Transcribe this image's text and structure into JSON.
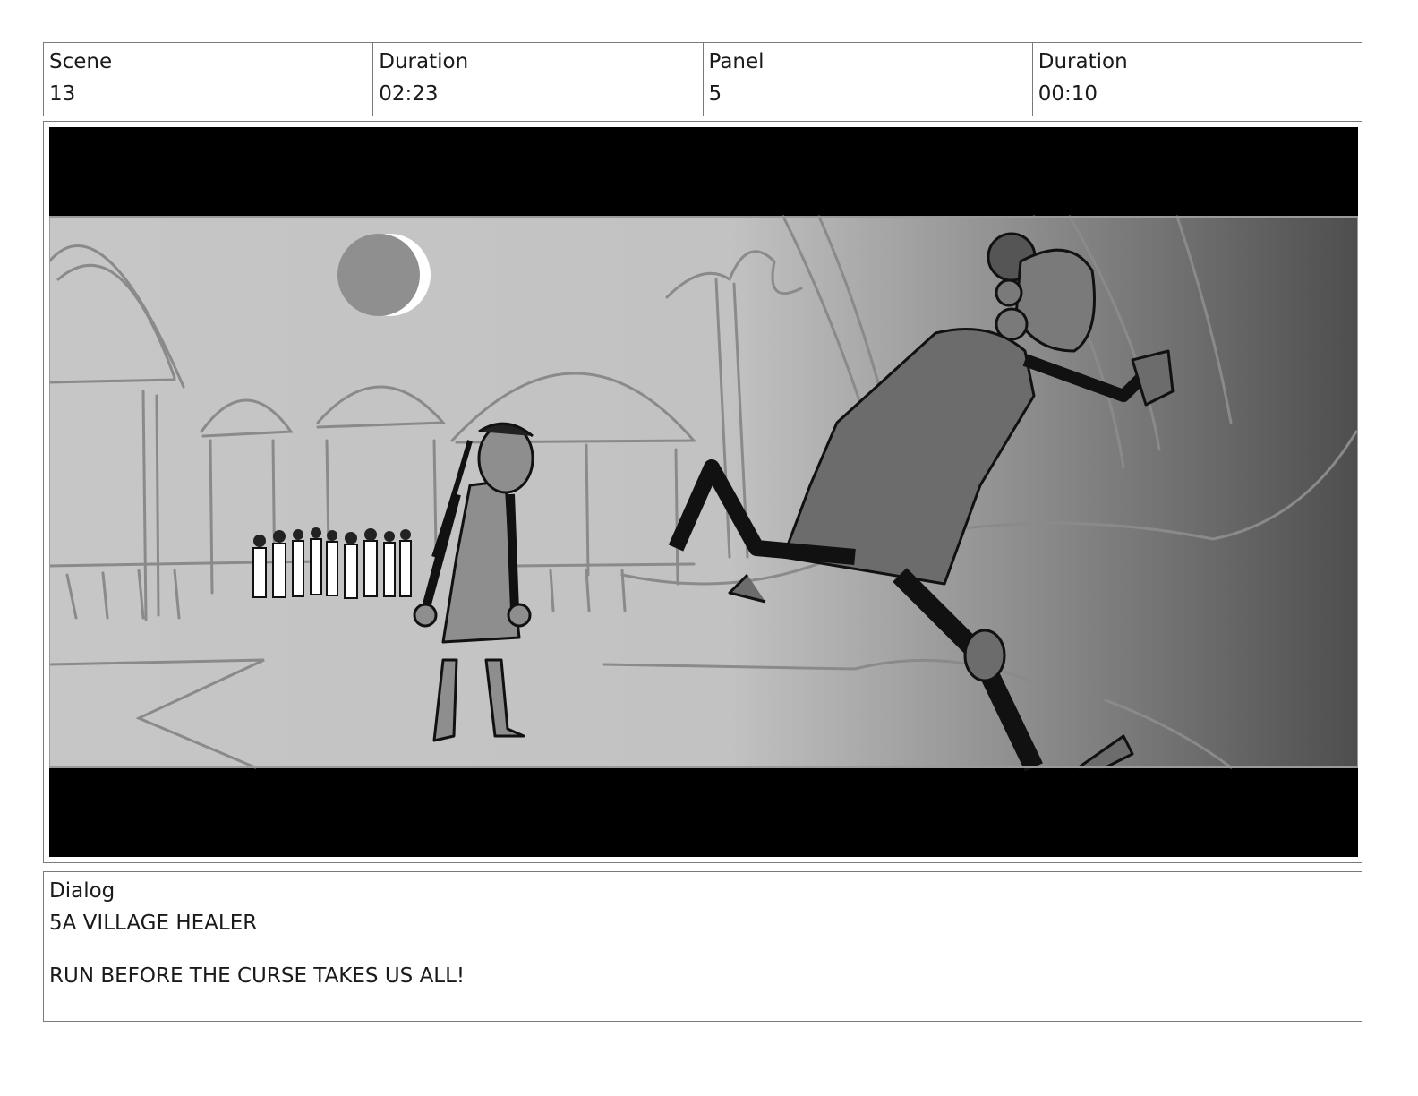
{
  "header": {
    "scene": {
      "label": "Scene",
      "value": "13"
    },
    "scene_duration": {
      "label": "Duration",
      "value": "02:23"
    },
    "panel": {
      "label": "Panel",
      "value": "5"
    },
    "panel_duration": {
      "label": "Duration",
      "value": "00:10"
    }
  },
  "dialog": {
    "label": "Dialog",
    "speaker": "5A VILLAGE HEALER",
    "line": "RUN BEFORE THE CURSE TAKES US ALL!"
  }
}
